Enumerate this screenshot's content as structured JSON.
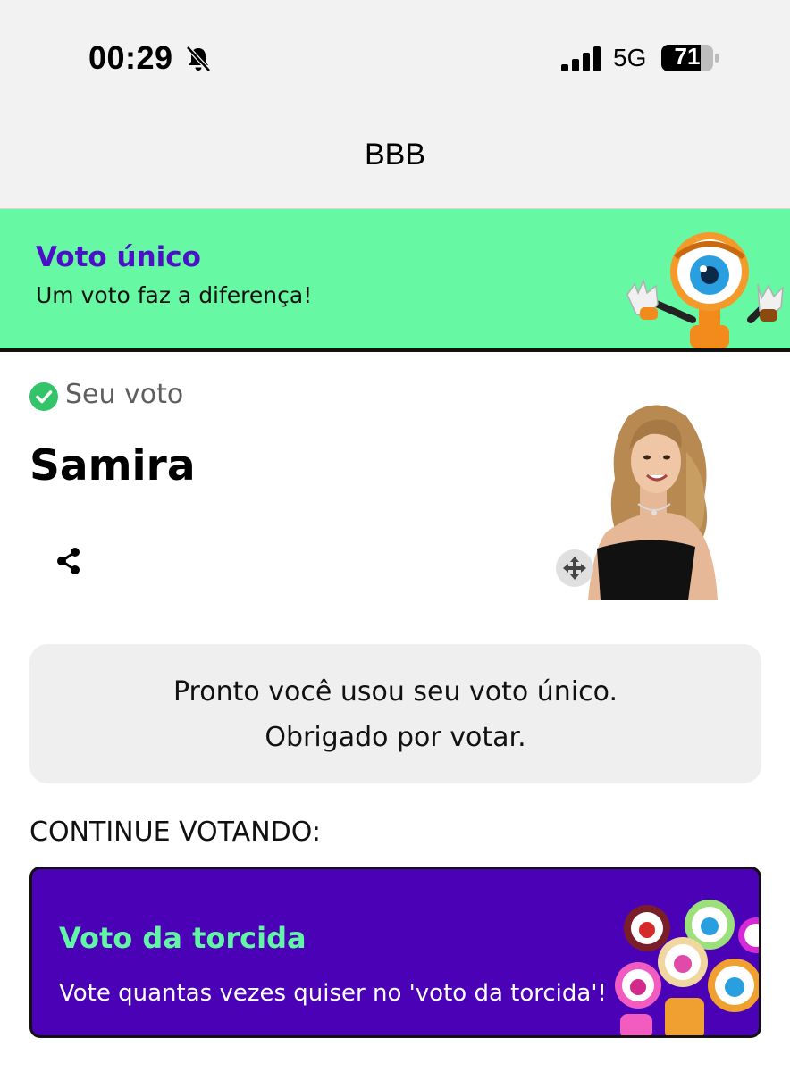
{
  "status_bar": {
    "time": "00:29",
    "network": "5G",
    "battery_level": "71",
    "icons": [
      "bell-muted-icon",
      "signal-icon",
      "battery-icon"
    ]
  },
  "nav": {
    "title": "BBB"
  },
  "banner": {
    "title": "Voto único",
    "subtitle": "Um voto faz a diferença!",
    "colors": {
      "background": "#66f8a2",
      "title": "#4b10c8"
    }
  },
  "vote": {
    "status_label": "Seu voto",
    "candidate_name": "Samira",
    "icons": [
      "check-circle-icon",
      "share-icon",
      "move-icon"
    ]
  },
  "info_box": {
    "line1": "Pronto você usou seu voto único.",
    "line2": "Obrigado por votar."
  },
  "continue_section": {
    "heading": "CONTINUE VOTANDO:",
    "card": {
      "title": "Voto da torcida",
      "subtitle": "Vote quantas vezes quiser no 'voto da torcida'!",
      "colors": {
        "background": "#4b01b5",
        "title": "#63f5a6"
      }
    }
  }
}
